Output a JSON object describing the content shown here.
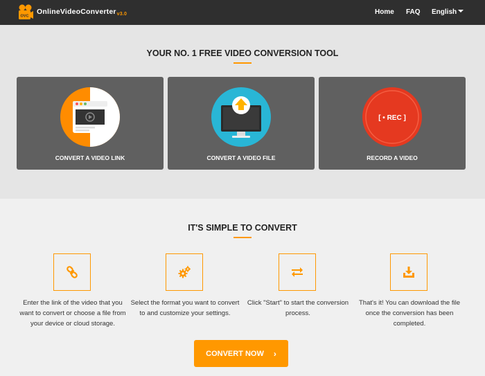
{
  "header": {
    "brand": "OnlineVideoConverter",
    "brand_logo_text": "OVC",
    "version": "v3.0",
    "nav": {
      "home": "Home",
      "faq": "FAQ",
      "language": "English"
    }
  },
  "hero": {
    "title": "YOUR NO. 1 FREE VIDEO CONVERSION TOOL",
    "cards": [
      {
        "label": "CONVERT A VIDEO LINK",
        "icon": "video-link-icon"
      },
      {
        "label": "CONVERT A VIDEO FILE",
        "icon": "upload-monitor-icon"
      },
      {
        "label": "RECORD A VIDEO",
        "icon": "record-icon",
        "badge": "[ • REC ]"
      }
    ]
  },
  "steps": {
    "title": "IT'S SIMPLE TO CONVERT",
    "items": [
      {
        "icon": "link-icon",
        "text": "Enter the link of the video that you want to convert or choose a file from your device or cloud storage."
      },
      {
        "icon": "gears-icon",
        "text": "Select the format you want to convert to and customize your settings."
      },
      {
        "icon": "swap-arrows-icon",
        "text": "Click \"Start\" to start the conversion process."
      },
      {
        "icon": "download-icon",
        "text": "That's it! You can download the file once the conversion has been completed."
      }
    ],
    "cta": "CONVERT NOW",
    "cta_icon": "chevron-right-icon"
  },
  "colors": {
    "accent": "#ff9800",
    "header_bg": "#2f2f2f",
    "card_bg": "#606060",
    "hero_bg": "#e5e5e5"
  }
}
